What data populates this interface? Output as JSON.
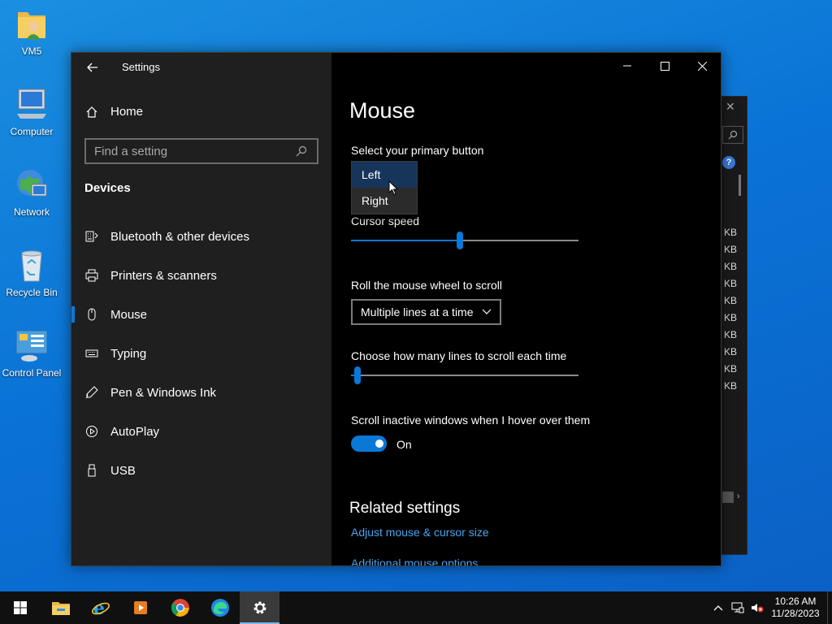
{
  "desktop": {
    "icons": [
      {
        "label": "VM5"
      },
      {
        "label": "Computer"
      },
      {
        "label": "Network"
      },
      {
        "label": "Recycle Bin"
      },
      {
        "label": "Control Panel"
      }
    ]
  },
  "background_window": {
    "size_labels": [
      "KB",
      "KB",
      "KB",
      "KB",
      "KB",
      "KB",
      "KB",
      "KB",
      "KB",
      "KB"
    ]
  },
  "settings": {
    "title": "Settings",
    "home_label": "Home",
    "search_placeholder": "Find a setting",
    "section": "Devices",
    "nav": [
      {
        "label": "Bluetooth & other devices",
        "icon": "bluetooth-keyboard-icon"
      },
      {
        "label": "Printers & scanners",
        "icon": "printer-icon"
      },
      {
        "label": "Mouse",
        "icon": "mouse-icon",
        "active": true
      },
      {
        "label": "Typing",
        "icon": "keyboard-icon"
      },
      {
        "label": "Pen & Windows Ink",
        "icon": "pen-icon"
      },
      {
        "label": "AutoPlay",
        "icon": "autoplay-icon"
      },
      {
        "label": "USB",
        "icon": "usb-icon"
      }
    ],
    "page_title": "Mouse",
    "primary_button": {
      "label": "Select your primary button",
      "options": [
        "Left",
        "Right"
      ],
      "selected": "Left"
    },
    "cursor_speed": {
      "label": "Cursor speed",
      "value_fraction": 0.48
    },
    "scroll": {
      "label": "Roll the mouse wheel to scroll",
      "value": "Multiple lines at a time"
    },
    "lines": {
      "label": "Choose how many lines to scroll each time",
      "value_fraction": 0.03
    },
    "inactive_scroll": {
      "label": "Scroll inactive windows when I hover over them",
      "state": "On"
    },
    "related": {
      "title": "Related settings",
      "links": [
        "Adjust mouse & cursor size",
        "Additional mouse options"
      ]
    }
  },
  "taskbar": {
    "time": "10:26 AM",
    "date": "11/28/2023",
    "accent": "#0a78d7"
  }
}
